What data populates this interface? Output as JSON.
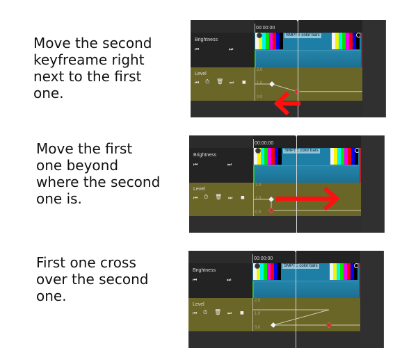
{
  "steps": [
    {
      "caption": "Move the second\nkeyfreame right\nnext to the first\none.",
      "timecode": "00:00:00",
      "clip_title": "SMPTE color bars",
      "tracks": {
        "brightness_label": "Brightness",
        "level_label": "Level"
      },
      "y_axis": [
        "2.0",
        "1.0",
        "0.0"
      ],
      "keyframes": [
        {
          "name": "first",
          "value": 1.0,
          "selected": false
        },
        {
          "name": "second",
          "value": 0.4,
          "selected": true
        }
      ],
      "arrow_direction": "left"
    },
    {
      "caption": "Move the first\none beyond\nwhere the second\none is.",
      "timecode": "00:00:00",
      "clip_title": "SMPTE color bars",
      "tracks": {
        "brightness_label": "Brightness",
        "level_label": "Level"
      },
      "y_axis": [
        "2.0",
        "1.0",
        "0.0"
      ],
      "keyframes": [
        {
          "name": "first",
          "value": 1.0,
          "selected": false
        },
        {
          "name": "second",
          "value": 0.0,
          "selected": true
        }
      ],
      "arrow_direction": "right"
    },
    {
      "caption": "First one cross\nover the second\none.",
      "timecode": "00:00:00",
      "clip_title": "SMPTE color bars",
      "tracks": {
        "brightness_label": "Brightness",
        "level_label": "Level"
      },
      "y_axis": [
        "2.0",
        "1.0",
        "0.0"
      ],
      "keyframes": [
        {
          "name": "first",
          "value": 0.0,
          "selected": false
        },
        {
          "name": "second",
          "value": 0.0,
          "selected": true
        }
      ],
      "arrow_direction": "none"
    }
  ],
  "controls": {
    "prev_keyframe_icon": "⏮",
    "next_keyframe_icon": "⏭",
    "timer_icon": "⏱",
    "trash_icon": "🗑",
    "stop_icon": "■"
  },
  "colors": {
    "keyframe_selected": "#e02828",
    "keyframe_normal": "#f4f4f4",
    "annotation_arrow": "#ff1010",
    "level_bg": "#6a6628",
    "clip_bg": "#1e7fa6"
  },
  "color_bars": [
    "#f4f4f4",
    "#f4f400",
    "#00f4f4",
    "#00e400",
    "#f400f4",
    "#f40000",
    "#0000f4",
    "#000000"
  ]
}
